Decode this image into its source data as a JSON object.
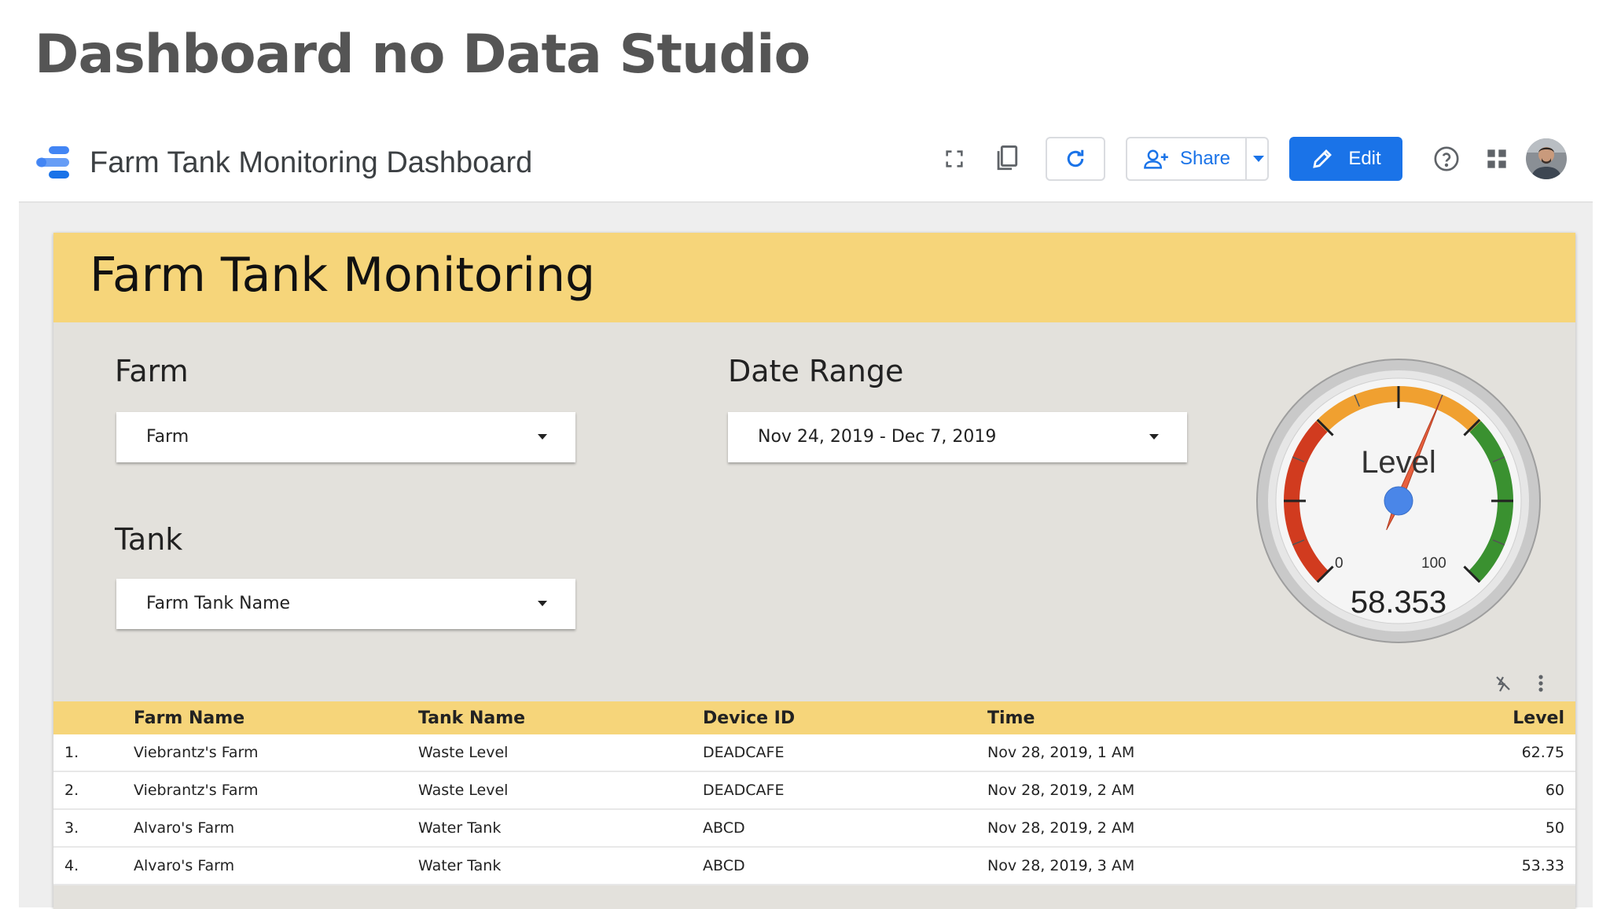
{
  "page": {
    "title": "Dashboard no Data Studio"
  },
  "app_bar": {
    "report_title": "Farm Tank Monitoring Dashboard",
    "share_label": "Share",
    "edit_label": "Edit",
    "accent_color": "#1a73e8",
    "icons": [
      "fullscreen-icon",
      "copy-icon",
      "refresh-icon",
      "add-person-icon",
      "chevron-down-icon",
      "pencil-icon",
      "help-icon",
      "apps-grid-icon",
      "user-avatar"
    ]
  },
  "report": {
    "heading": "Farm Tank Monitoring",
    "header_color": "#f6d57a",
    "farm_control": {
      "label": "Farm",
      "value": "Farm"
    },
    "date_control": {
      "label": "Date Range",
      "value": "Nov 24, 2019 - Dec 7, 2019"
    },
    "tank_control": {
      "label": "Tank",
      "value": "Farm Tank Name"
    },
    "gauge": {
      "title": "Level",
      "min_label": "0",
      "max_label": "100",
      "min": 0,
      "max": 100,
      "value": 58.353,
      "value_label": "58.353",
      "bands": [
        {
          "from": 0,
          "to": 33,
          "color": "#d13b1f"
        },
        {
          "from": 33,
          "to": 67,
          "color": "#f0a030"
        },
        {
          "from": 67,
          "to": 100,
          "color": "#3a9130"
        }
      ]
    },
    "table": {
      "columns": [
        "Farm Name",
        "Tank Name",
        "Device ID",
        "Time",
        "Level"
      ],
      "rows": [
        {
          "num": "1.",
          "farm": "Viebrantz's Farm",
          "tank": "Waste Level",
          "device": "DEADCAFE",
          "time": "Nov 28, 2019, 1 AM",
          "level": "62.75"
        },
        {
          "num": "2.",
          "farm": "Viebrantz's Farm",
          "tank": "Waste Level",
          "device": "DEADCAFE",
          "time": "Nov 28, 2019, 2 AM",
          "level": "60"
        },
        {
          "num": "3.",
          "farm": "Alvaro's Farm",
          "tank": "Water Tank",
          "device": "ABCD",
          "time": "Nov 28, 2019, 2 AM",
          "level": "50"
        },
        {
          "num": "4.",
          "farm": "Alvaro's Farm",
          "tank": "Water Tank",
          "device": "ABCD",
          "time": "Nov 28, 2019, 3 AM",
          "level": "53.33"
        }
      ]
    }
  }
}
